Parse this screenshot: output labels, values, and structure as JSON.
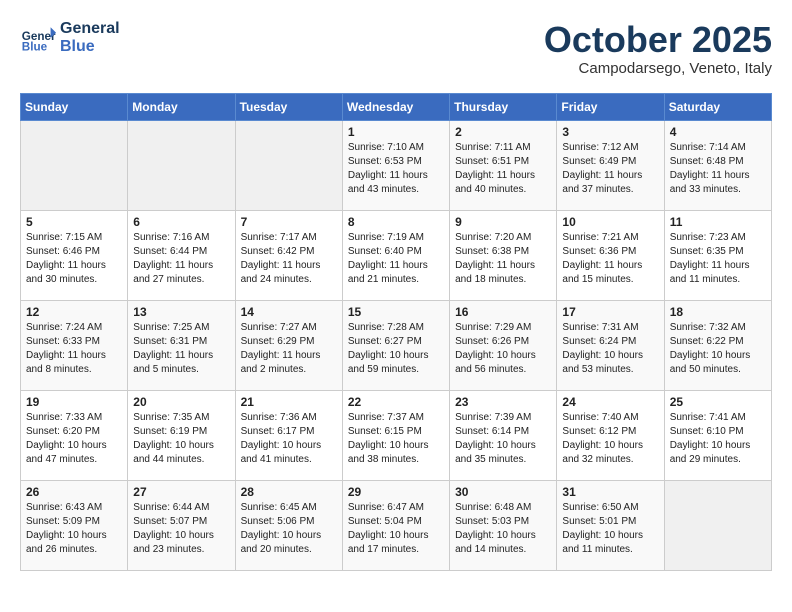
{
  "header": {
    "logo_line1": "General",
    "logo_line2": "Blue",
    "month": "October 2025",
    "location": "Campodarsego, Veneto, Italy"
  },
  "days_of_week": [
    "Sunday",
    "Monday",
    "Tuesday",
    "Wednesday",
    "Thursday",
    "Friday",
    "Saturday"
  ],
  "weeks": [
    [
      {
        "day": "",
        "info": ""
      },
      {
        "day": "",
        "info": ""
      },
      {
        "day": "",
        "info": ""
      },
      {
        "day": "1",
        "info": "Sunrise: 7:10 AM\nSunset: 6:53 PM\nDaylight: 11 hours\nand 43 minutes."
      },
      {
        "day": "2",
        "info": "Sunrise: 7:11 AM\nSunset: 6:51 PM\nDaylight: 11 hours\nand 40 minutes."
      },
      {
        "day": "3",
        "info": "Sunrise: 7:12 AM\nSunset: 6:49 PM\nDaylight: 11 hours\nand 37 minutes."
      },
      {
        "day": "4",
        "info": "Sunrise: 7:14 AM\nSunset: 6:48 PM\nDaylight: 11 hours\nand 33 minutes."
      }
    ],
    [
      {
        "day": "5",
        "info": "Sunrise: 7:15 AM\nSunset: 6:46 PM\nDaylight: 11 hours\nand 30 minutes."
      },
      {
        "day": "6",
        "info": "Sunrise: 7:16 AM\nSunset: 6:44 PM\nDaylight: 11 hours\nand 27 minutes."
      },
      {
        "day": "7",
        "info": "Sunrise: 7:17 AM\nSunset: 6:42 PM\nDaylight: 11 hours\nand 24 minutes."
      },
      {
        "day": "8",
        "info": "Sunrise: 7:19 AM\nSunset: 6:40 PM\nDaylight: 11 hours\nand 21 minutes."
      },
      {
        "day": "9",
        "info": "Sunrise: 7:20 AM\nSunset: 6:38 PM\nDaylight: 11 hours\nand 18 minutes."
      },
      {
        "day": "10",
        "info": "Sunrise: 7:21 AM\nSunset: 6:36 PM\nDaylight: 11 hours\nand 15 minutes."
      },
      {
        "day": "11",
        "info": "Sunrise: 7:23 AM\nSunset: 6:35 PM\nDaylight: 11 hours\nand 11 minutes."
      }
    ],
    [
      {
        "day": "12",
        "info": "Sunrise: 7:24 AM\nSunset: 6:33 PM\nDaylight: 11 hours\nand 8 minutes."
      },
      {
        "day": "13",
        "info": "Sunrise: 7:25 AM\nSunset: 6:31 PM\nDaylight: 11 hours\nand 5 minutes."
      },
      {
        "day": "14",
        "info": "Sunrise: 7:27 AM\nSunset: 6:29 PM\nDaylight: 11 hours\nand 2 minutes."
      },
      {
        "day": "15",
        "info": "Sunrise: 7:28 AM\nSunset: 6:27 PM\nDaylight: 10 hours\nand 59 minutes."
      },
      {
        "day": "16",
        "info": "Sunrise: 7:29 AM\nSunset: 6:26 PM\nDaylight: 10 hours\nand 56 minutes."
      },
      {
        "day": "17",
        "info": "Sunrise: 7:31 AM\nSunset: 6:24 PM\nDaylight: 10 hours\nand 53 minutes."
      },
      {
        "day": "18",
        "info": "Sunrise: 7:32 AM\nSunset: 6:22 PM\nDaylight: 10 hours\nand 50 minutes."
      }
    ],
    [
      {
        "day": "19",
        "info": "Sunrise: 7:33 AM\nSunset: 6:20 PM\nDaylight: 10 hours\nand 47 minutes."
      },
      {
        "day": "20",
        "info": "Sunrise: 7:35 AM\nSunset: 6:19 PM\nDaylight: 10 hours\nand 44 minutes."
      },
      {
        "day": "21",
        "info": "Sunrise: 7:36 AM\nSunset: 6:17 PM\nDaylight: 10 hours\nand 41 minutes."
      },
      {
        "day": "22",
        "info": "Sunrise: 7:37 AM\nSunset: 6:15 PM\nDaylight: 10 hours\nand 38 minutes."
      },
      {
        "day": "23",
        "info": "Sunrise: 7:39 AM\nSunset: 6:14 PM\nDaylight: 10 hours\nand 35 minutes."
      },
      {
        "day": "24",
        "info": "Sunrise: 7:40 AM\nSunset: 6:12 PM\nDaylight: 10 hours\nand 32 minutes."
      },
      {
        "day": "25",
        "info": "Sunrise: 7:41 AM\nSunset: 6:10 PM\nDaylight: 10 hours\nand 29 minutes."
      }
    ],
    [
      {
        "day": "26",
        "info": "Sunrise: 6:43 AM\nSunset: 5:09 PM\nDaylight: 10 hours\nand 26 minutes."
      },
      {
        "day": "27",
        "info": "Sunrise: 6:44 AM\nSunset: 5:07 PM\nDaylight: 10 hours\nand 23 minutes."
      },
      {
        "day": "28",
        "info": "Sunrise: 6:45 AM\nSunset: 5:06 PM\nDaylight: 10 hours\nand 20 minutes."
      },
      {
        "day": "29",
        "info": "Sunrise: 6:47 AM\nSunset: 5:04 PM\nDaylight: 10 hours\nand 17 minutes."
      },
      {
        "day": "30",
        "info": "Sunrise: 6:48 AM\nSunset: 5:03 PM\nDaylight: 10 hours\nand 14 minutes."
      },
      {
        "day": "31",
        "info": "Sunrise: 6:50 AM\nSunset: 5:01 PM\nDaylight: 10 hours\nand 11 minutes."
      },
      {
        "day": "",
        "info": ""
      }
    ]
  ]
}
